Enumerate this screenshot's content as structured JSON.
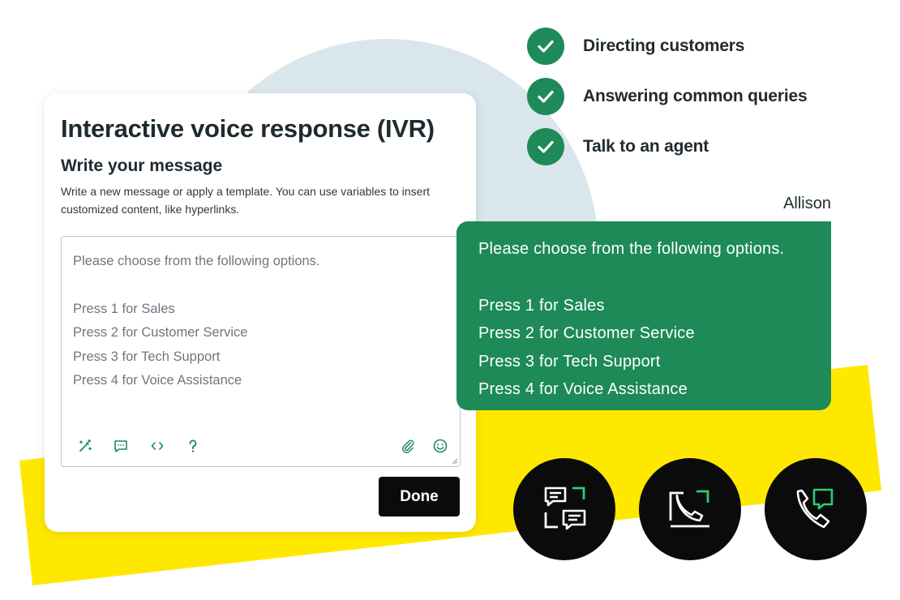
{
  "checklist": [
    {
      "label": "Directing customers",
      "icon": "check-icon"
    },
    {
      "label": "Answering common queries",
      "icon": "check-icon"
    },
    {
      "label": "Talk to an agent",
      "icon": "check-icon"
    }
  ],
  "card": {
    "title": "Interactive voice response (IVR)",
    "subtitle": "Write your message",
    "description": "Write a new message or apply a template. You can use variables to insert customized content, like hyperlinks.",
    "editor": {
      "line1": "Please choose from the following options.",
      "options": [
        "Press 1 for Sales",
        "Press 2 for Customer Service",
        "Press 3 for Tech Support",
        "Press 4 for Voice Assistance"
      ]
    },
    "toolbar_left": [
      "magic-wand-icon",
      "comment-icon",
      "code-icon",
      "help-icon"
    ],
    "toolbar_right": [
      "paperclip-icon",
      "emoji-icon"
    ],
    "done_label": "Done"
  },
  "speaker": "Allison",
  "bubble": {
    "line1": "Please choose from the following options.",
    "options": [
      "Press 1 for Sales",
      "Press 2 for Customer Service",
      "Press 3 for Tech Support",
      "Press 4 for Voice Assistance"
    ]
  },
  "channels": [
    "messaging-channel-icon",
    "voice-ticket-icon",
    "phone-chat-icon"
  ],
  "colors": {
    "accent_green": "#1d8a58",
    "bright_green": "#2ecc71",
    "yellow": "#ffe800",
    "circle_blue": "#d9e6ec",
    "black": "#0b0b0b"
  }
}
